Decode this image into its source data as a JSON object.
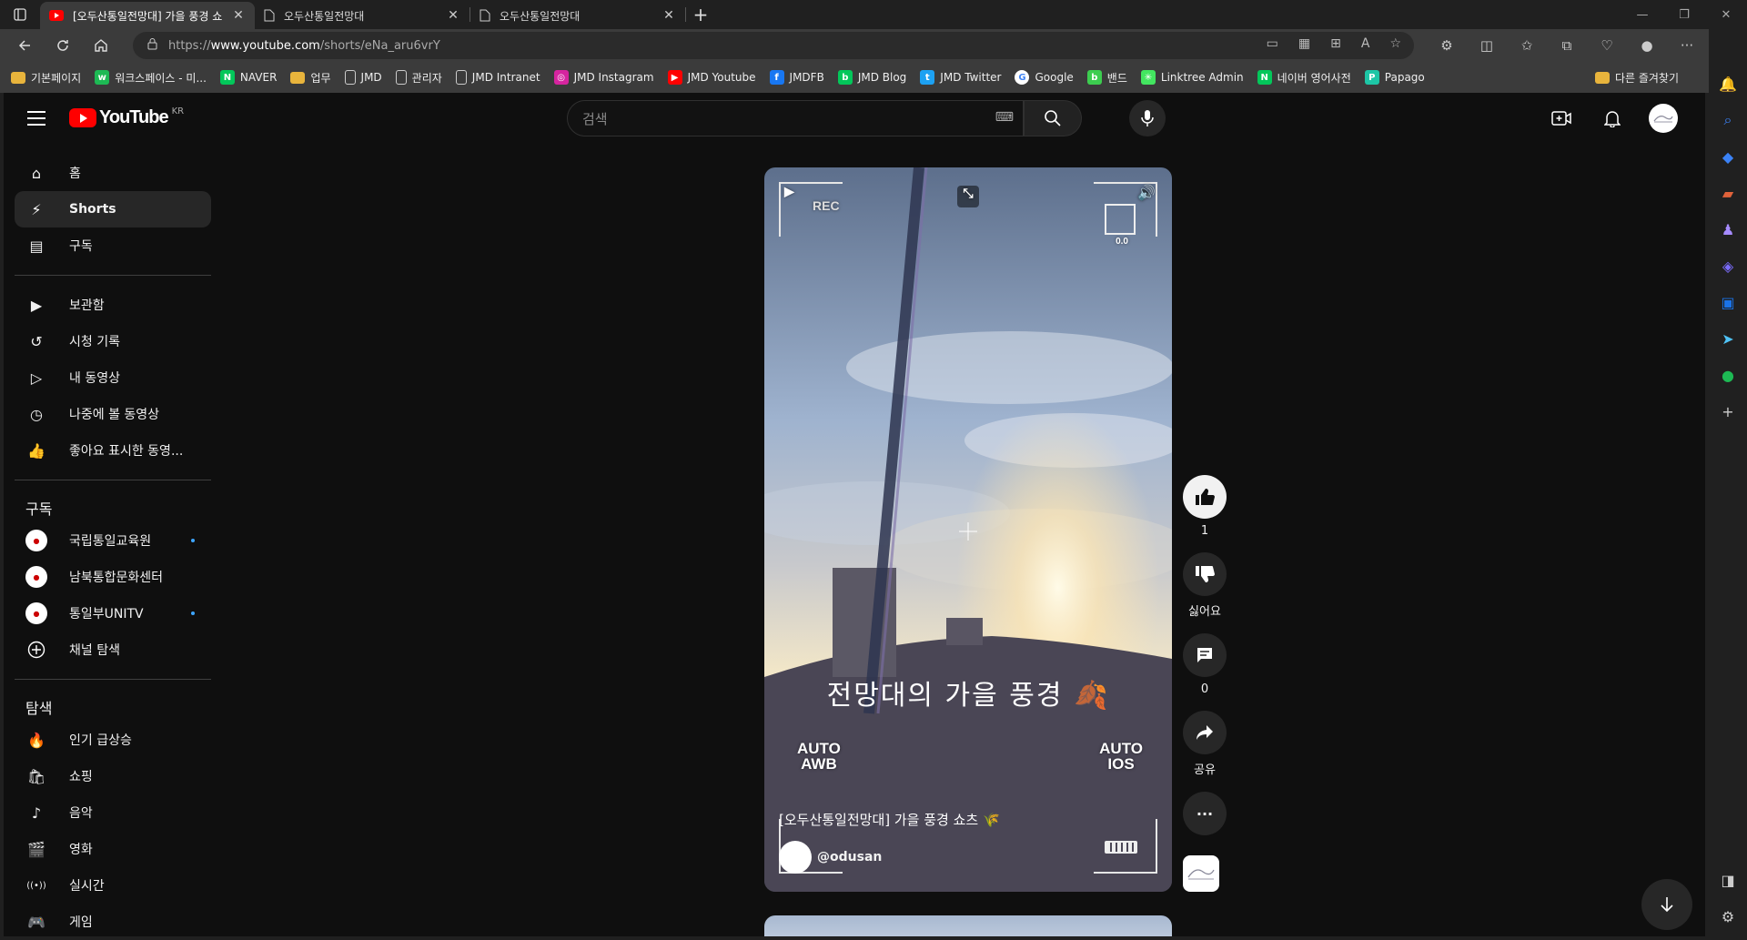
{
  "browser": {
    "tabs": [
      {
        "title": "[오두산통일전망대] 가을 풍경 쇼",
        "active": true
      },
      {
        "title": "오두산통일전망대",
        "active": false
      },
      {
        "title": "오두산통일전망대",
        "active": false
      }
    ],
    "url_prefix": "https://",
    "url_host": "www.youtube.com",
    "url_path": "/shorts/eNa_aru6vrY",
    "bookmarks": [
      {
        "label": "기본페이지",
        "icon": "folder-icon",
        "color": "#e8b43c"
      },
      {
        "label": "워크스페이스 - 미...",
        "icon": "workspace-icon",
        "color": "#1db954"
      },
      {
        "label": "NAVER",
        "icon": "naver-icon",
        "color": "#03c75a"
      },
      {
        "label": "업무",
        "icon": "folder-icon",
        "color": "#e8b43c"
      },
      {
        "label": "JMD",
        "icon": "page-icon",
        "color": "#cccccc"
      },
      {
        "label": "관리자",
        "icon": "page-icon",
        "color": "#cccccc"
      },
      {
        "label": "JMD Intranet",
        "icon": "page-icon",
        "color": "#cccccc"
      },
      {
        "label": "JMD Instagram",
        "icon": "instagram-icon",
        "color": "#d6249f"
      },
      {
        "label": "JMD Youtube",
        "icon": "youtube-icon",
        "color": "#ff0000"
      },
      {
        "label": "JMDFB",
        "icon": "facebook-icon",
        "color": "#1877f2"
      },
      {
        "label": "JMD Blog",
        "icon": "blog-icon",
        "color": "#03c75a"
      },
      {
        "label": "JMD Twitter",
        "icon": "twitter-icon",
        "color": "#1da1f2"
      },
      {
        "label": "Google",
        "icon": "google-icon",
        "color": "#ffffff"
      },
      {
        "label": "밴드",
        "icon": "band-icon",
        "color": "#3ccd4f"
      },
      {
        "label": "Linktree Admin",
        "icon": "linktree-icon",
        "color": "#43e660"
      },
      {
        "label": "네이버 영어사전",
        "icon": "naver-dict-icon",
        "color": "#03c75a"
      },
      {
        "label": "Papago",
        "icon": "papago-icon",
        "color": "#1dc6a6"
      }
    ],
    "other_favorites": "다른 즐겨찾기"
  },
  "youtube": {
    "logo_text": "YouTube",
    "region": "KR",
    "search_placeholder": "검색",
    "nav_primary": [
      {
        "label": "홈",
        "icon": "home-icon",
        "active": false
      },
      {
        "label": "Shorts",
        "icon": "shorts-icon",
        "active": true
      },
      {
        "label": "구독",
        "icon": "subscriptions-icon",
        "active": false
      }
    ],
    "nav_library": [
      {
        "label": "보관함",
        "icon": "library-icon"
      },
      {
        "label": "시청 기록",
        "icon": "history-icon"
      },
      {
        "label": "내 동영상",
        "icon": "my-videos-icon"
      },
      {
        "label": "나중에 볼 동영상",
        "icon": "watch-later-icon"
      },
      {
        "label": "좋아요 표시한 동영...",
        "icon": "liked-icon"
      }
    ],
    "subs_heading": "구독",
    "subscriptions": [
      {
        "label": "국립통일교육원",
        "new": true
      },
      {
        "label": "남북통합문화센터",
        "new": false
      },
      {
        "label": "통일부UNITV",
        "new": true
      },
      {
        "label": "채널 탐색",
        "new": false
      }
    ],
    "explore_heading": "탐색",
    "explore": [
      {
        "label": "인기 급상승",
        "icon": "trending-icon"
      },
      {
        "label": "쇼핑",
        "icon": "shopping-icon"
      },
      {
        "label": "음악",
        "icon": "music-icon"
      },
      {
        "label": "영화",
        "icon": "movies-icon"
      },
      {
        "label": "실시간",
        "icon": "live-icon"
      },
      {
        "label": "게임",
        "icon": "gaming-icon"
      }
    ],
    "short": {
      "overlay_rec": "REC",
      "overlay_exposure": "0.0",
      "overlay_awb": "AUTO\nAWB",
      "overlay_ios": "AUTO\nIOS",
      "caption": "전망대의 가을 풍경 🍂",
      "title": "[오두산통일전망대] 가을 풍경 쇼츠 🌾",
      "channel": "@odusan"
    },
    "actions": {
      "like_count": "1",
      "dislike_label": "싫어요",
      "comment_count": "0",
      "share_label": "공유"
    }
  }
}
